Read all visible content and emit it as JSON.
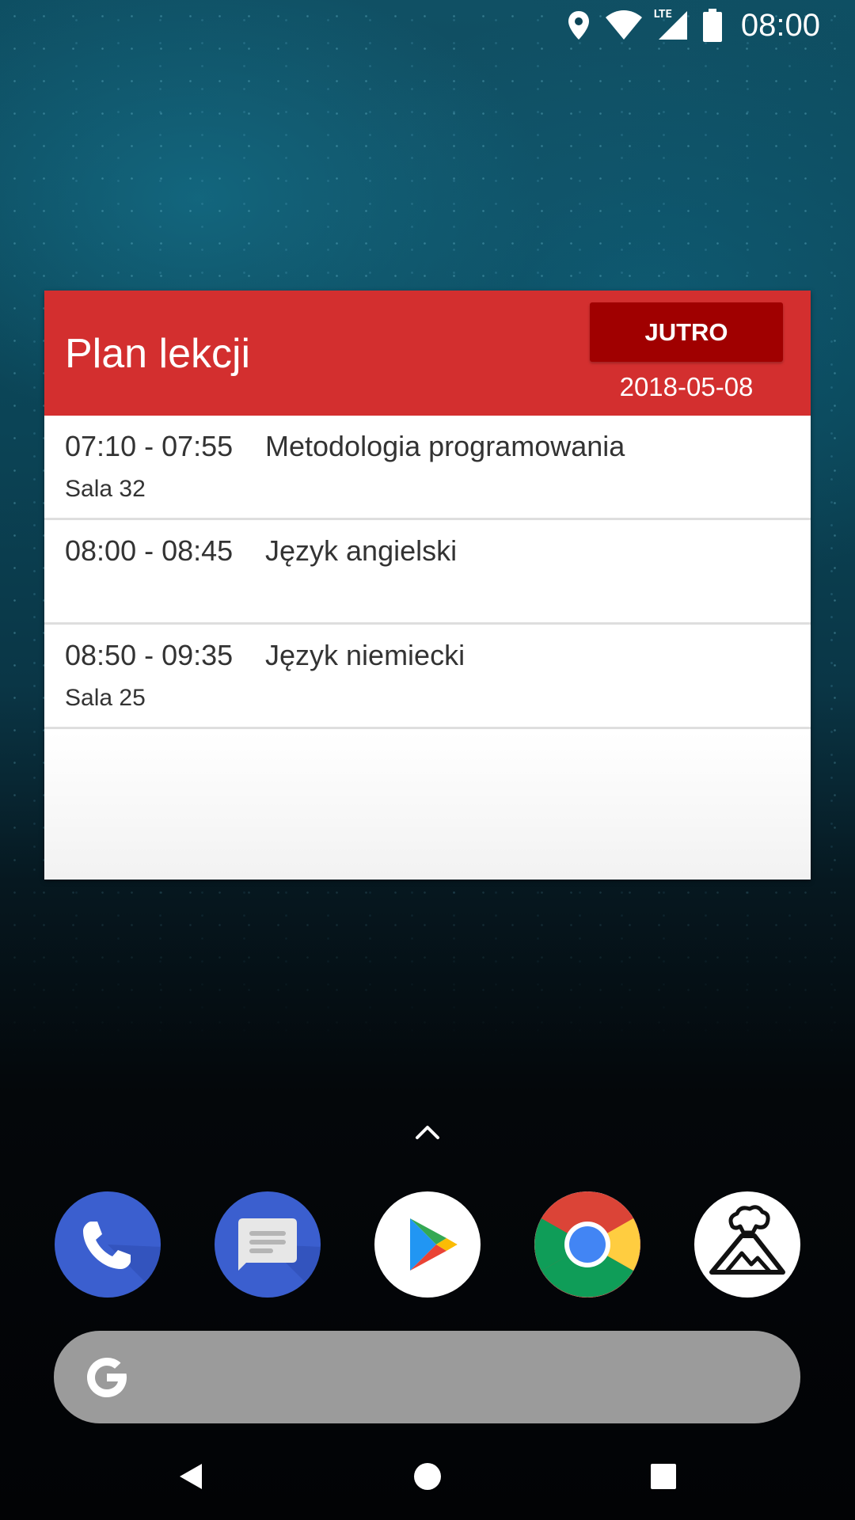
{
  "status_bar": {
    "time": "08:00",
    "icons": [
      "location-icon",
      "wifi-icon",
      "lte-signal-icon",
      "battery-icon"
    ],
    "network_label": "LTE"
  },
  "widget": {
    "title": "Plan lekcji",
    "tomorrow_button_label": "JUTRO",
    "date": "2018-05-08",
    "header_color": "#d32f2f",
    "button_color": "#a00000",
    "lessons": [
      {
        "time": "07:10 - 07:55",
        "subject": "Metodologia programowania",
        "room": "Sala 32"
      },
      {
        "time": "08:00 - 08:45",
        "subject": "Język angielski",
        "room": ""
      },
      {
        "time": "08:50 - 09:35",
        "subject": "Język niemiecki",
        "room": "Sala 25"
      }
    ]
  },
  "dock": {
    "apps": [
      "phone-app-icon",
      "messages-app-icon",
      "play-store-app-icon",
      "chrome-app-icon",
      "volcano-app-icon"
    ]
  },
  "search": {
    "icon": "google-g-icon"
  },
  "nav_bar": {
    "buttons": [
      "back-icon",
      "home-icon",
      "recents-icon"
    ]
  }
}
